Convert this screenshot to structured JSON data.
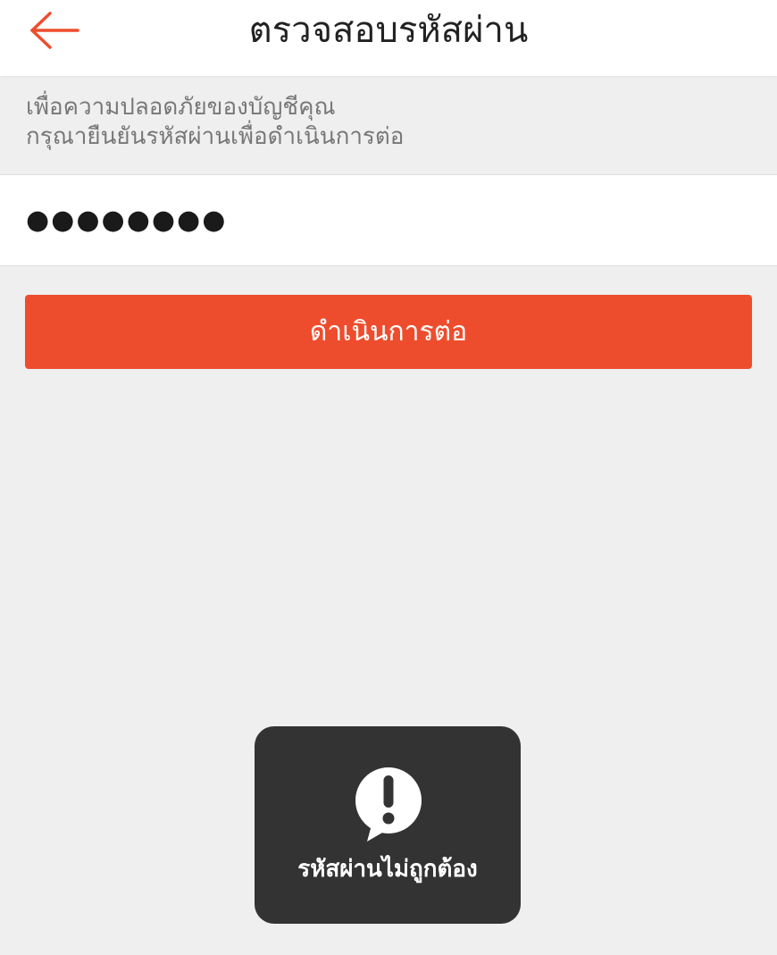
{
  "header": {
    "title": "ตรวจสอบรหัสผ่าน",
    "back_icon": "back-arrow-icon",
    "accent_color": "#ee4d2d"
  },
  "info": {
    "line1": "เพื่อความปลอดภัยของบัญชีคุณ",
    "line2": "กรุณายืนยันรหัสผ่านเพื่อดำเนินการต่อ"
  },
  "password_field": {
    "value": "●●●●●●●●"
  },
  "continue_button": {
    "label": "ดำเนินการต่อ",
    "color": "#ee4d2d"
  },
  "toast": {
    "icon": "alert-speech-bubble-icon",
    "message": "รหัสผ่านไม่ถูกต้อง"
  }
}
